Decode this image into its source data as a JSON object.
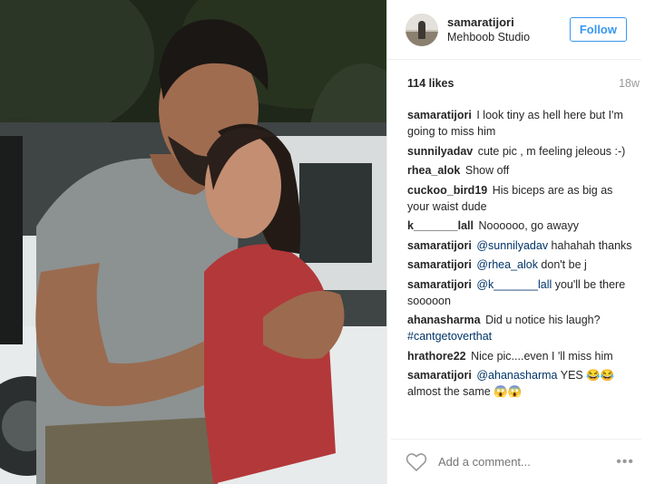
{
  "post": {
    "username": "samaratijori",
    "location": "Mehboob Studio",
    "follow_label": "Follow",
    "likes": "114 likes",
    "age": "18w",
    "comments": [
      {
        "user": "samaratijori",
        "parts": [
          {
            "t": "I look tiny as hell here but I'm going to miss him"
          }
        ]
      },
      {
        "user": "sunnilyadav",
        "parts": [
          {
            "t": "cute pic , m feeling jeleous :-)"
          }
        ]
      },
      {
        "user": "rhea_alok",
        "parts": [
          {
            "t": "Show off"
          }
        ]
      },
      {
        "user": "cuckoo_bird19",
        "parts": [
          {
            "t": "His biceps are as big as your waist dude"
          }
        ]
      },
      {
        "user": "k_______lall",
        "parts": [
          {
            "t": "Noooooo, go awayy"
          }
        ]
      },
      {
        "user": "samaratijori",
        "parts": [
          {
            "t": "@sunnilyadav",
            "mention": true
          },
          {
            "t": " hahahah thanks"
          }
        ]
      },
      {
        "user": "samaratijori",
        "parts": [
          {
            "t": "@rhea_alok",
            "mention": true
          },
          {
            "t": " don't be j"
          }
        ]
      },
      {
        "user": "samaratijori",
        "parts": [
          {
            "t": "@k_______lall",
            "mention": true
          },
          {
            "t": " you'll be there sooooon"
          }
        ]
      },
      {
        "user": "ahanasharma",
        "parts": [
          {
            "t": "Did u notice his laugh? "
          },
          {
            "t": "#cantgetoverthat",
            "mention": true
          }
        ]
      },
      {
        "user": "hrathore22",
        "parts": [
          {
            "t": "Nice pic....even I 'll miss him"
          }
        ]
      },
      {
        "user": "samaratijori",
        "parts": [
          {
            "t": "@ahanasharma",
            "mention": true
          },
          {
            "t": " YES 😂😂 almost the same 😱😱"
          }
        ]
      }
    ],
    "add_comment_placeholder": "Add a comment...",
    "more_label": "•••"
  },
  "icons": {
    "like": "heart-outline-icon",
    "options": "more-options-icon"
  },
  "colors": {
    "follow": "#3897f0",
    "mention": "#003569",
    "muted": "#999999",
    "text": "#262626"
  }
}
